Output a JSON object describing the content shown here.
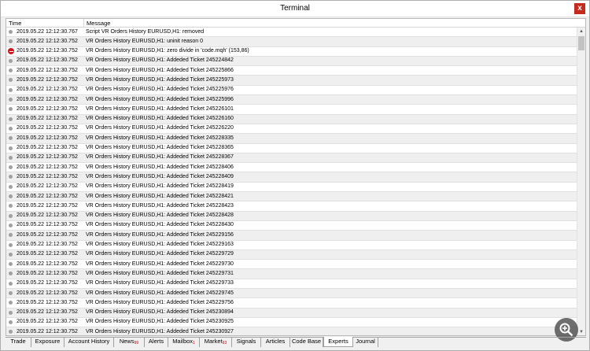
{
  "window": {
    "title": "Terminal",
    "close_label": "x"
  },
  "grid": {
    "columns": {
      "time": "Time",
      "message": "Message"
    },
    "rows": [
      {
        "time": "2019.05.22 12:12:30.767",
        "message": "Script VR Orders History EURUSD,H1: removed",
        "icon": "info"
      },
      {
        "time": "2019.05.22 12:12:30.752",
        "message": "VR Orders History EURUSD,H1: uninit reason 0",
        "icon": "info"
      },
      {
        "time": "2019.05.22 12:12:30.752",
        "message": "VR Orders History EURUSD,H1: zero divide in 'code.mqh' (153,86)",
        "icon": "error"
      },
      {
        "time": "2019.05.22 12:12:30.752",
        "message": "VR Orders History EURUSD,H1: Addeded Ticket 245224842",
        "icon": "info"
      },
      {
        "time": "2019.05.22 12:12:30.752",
        "message": "VR Orders History EURUSD,H1: Addeded Ticket 245225866",
        "icon": "info"
      },
      {
        "time": "2019.05.22 12:12:30.752",
        "message": "VR Orders History EURUSD,H1: Addeded Ticket 245225973",
        "icon": "info"
      },
      {
        "time": "2019.05.22 12:12:30.752",
        "message": "VR Orders History EURUSD,H1: Addeded Ticket 245225976",
        "icon": "info"
      },
      {
        "time": "2019.05.22 12:12:30.752",
        "message": "VR Orders History EURUSD,H1: Addeded Ticket 245225996",
        "icon": "info"
      },
      {
        "time": "2019.05.22 12:12:30.752",
        "message": "VR Orders History EURUSD,H1: Addeded Ticket 245226101",
        "icon": "info"
      },
      {
        "time": "2019.05.22 12:12:30.752",
        "message": "VR Orders History EURUSD,H1: Addeded Ticket 245226160",
        "icon": "info"
      },
      {
        "time": "2019.05.22 12:12:30.752",
        "message": "VR Orders History EURUSD,H1: Addeded Ticket 245226220",
        "icon": "info"
      },
      {
        "time": "2019.05.22 12:12:30.752",
        "message": "VR Orders History EURUSD,H1: Addeded Ticket 245228335",
        "icon": "info"
      },
      {
        "time": "2019.05.22 12:12:30.752",
        "message": "VR Orders History EURUSD,H1: Addeded Ticket 245228365",
        "icon": "info"
      },
      {
        "time": "2019.05.22 12:12:30.752",
        "message": "VR Orders History EURUSD,H1: Addeded Ticket 245228367",
        "icon": "info"
      },
      {
        "time": "2019.05.22 12:12:30.752",
        "message": "VR Orders History EURUSD,H1: Addeded Ticket 245228406",
        "icon": "info"
      },
      {
        "time": "2019.05.22 12:12:30.752",
        "message": "VR Orders History EURUSD,H1: Addeded Ticket 245228409",
        "icon": "info"
      },
      {
        "time": "2019.05.22 12:12:30.752",
        "message": "VR Orders History EURUSD,H1: Addeded Ticket 245228419",
        "icon": "info"
      },
      {
        "time": "2019.05.22 12:12:30.752",
        "message": "VR Orders History EURUSD,H1: Addeded Ticket 245228421",
        "icon": "info"
      },
      {
        "time": "2019.05.22 12:12:30.752",
        "message": "VR Orders History EURUSD,H1: Addeded Ticket 245228423",
        "icon": "info"
      },
      {
        "time": "2019.05.22 12:12:30.752",
        "message": "VR Orders History EURUSD,H1: Addeded Ticket 245228428",
        "icon": "info"
      },
      {
        "time": "2019.05.22 12:12:30.752",
        "message": "VR Orders History EURUSD,H1: Addeded Ticket 245228430",
        "icon": "info"
      },
      {
        "time": "2019.05.22 12:12:30.752",
        "message": "VR Orders History EURUSD,H1: Addeded Ticket 245229156",
        "icon": "info"
      },
      {
        "time": "2019.05.22 12:12:30.752",
        "message": "VR Orders History EURUSD,H1: Addeded Ticket 245229163",
        "icon": "info"
      },
      {
        "time": "2019.05.22 12:12:30.752",
        "message": "VR Orders History EURUSD,H1: Addeded Ticket 245229729",
        "icon": "info"
      },
      {
        "time": "2019.05.22 12:12:30.752",
        "message": "VR Orders History EURUSD,H1: Addeded Ticket 245229730",
        "icon": "info"
      },
      {
        "time": "2019.05.22 12:12:30.752",
        "message": "VR Orders History EURUSD,H1: Addeded Ticket 245229731",
        "icon": "info"
      },
      {
        "time": "2019.05.22 12:12:30.752",
        "message": "VR Orders History EURUSD,H1: Addeded Ticket 245229733",
        "icon": "info"
      },
      {
        "time": "2019.05.22 12:12:30.752",
        "message": "VR Orders History EURUSD,H1: Addeded Ticket 245229745",
        "icon": "info"
      },
      {
        "time": "2019.05.22 12:12:30.752",
        "message": "VR Orders History EURUSD,H1: Addeded Ticket 245229756",
        "icon": "info"
      },
      {
        "time": "2019.05.22 12:12:30.752",
        "message": "VR Orders History EURUSD,H1: Addeded Ticket 245230894",
        "icon": "info"
      },
      {
        "time": "2019.05.22 12:12:30.752",
        "message": "VR Orders History EURUSD,H1: Addeded Ticket 245230925",
        "icon": "info"
      },
      {
        "time": "2019.05.22 12:12:30.752",
        "message": "VR Orders History EURUSD,H1: Addeded Ticket 245230927",
        "icon": "info"
      }
    ]
  },
  "tabs": [
    {
      "label": "Trade",
      "badge": "",
      "active": false
    },
    {
      "label": "Exposure",
      "badge": "",
      "active": false
    },
    {
      "label": "Account History",
      "badge": "",
      "active": false
    },
    {
      "label": "News",
      "badge": "99",
      "active": false
    },
    {
      "label": "Alerts",
      "badge": "",
      "active": false
    },
    {
      "label": "Mailbox",
      "badge": "1",
      "active": false
    },
    {
      "label": "Market",
      "badge": "93",
      "active": false
    },
    {
      "label": "Signals",
      "badge": "",
      "active": false
    },
    {
      "label": "Articles",
      "badge": "",
      "active": false
    },
    {
      "label": "Code Base",
      "badge": "",
      "active": false
    },
    {
      "label": "Experts",
      "badge": "",
      "active": true
    },
    {
      "label": "Journal",
      "badge": "",
      "active": false
    }
  ],
  "icons": {
    "zoom": "zoom-in-icon",
    "close": "close-icon",
    "error": "error-icon",
    "info": "info-dot-icon"
  },
  "colors": {
    "error": "#d0161a",
    "badge": "#c00000",
    "close": "#c42b1c"
  }
}
